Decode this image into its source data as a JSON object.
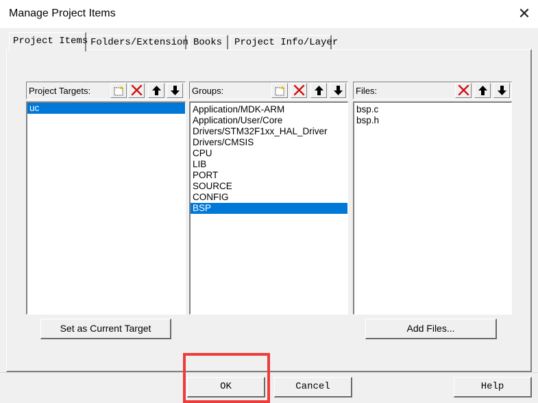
{
  "window": {
    "title": "Manage Project Items",
    "close_glyph": "✕"
  },
  "tabs": [
    {
      "label": "Project Items",
      "active": true
    },
    {
      "label": "Folders/Extensions",
      "active": false
    },
    {
      "label": "Books",
      "active": false
    },
    {
      "label": "Project Info/Layer",
      "active": false
    }
  ],
  "targets": {
    "label": "Project Targets:",
    "items": [
      "uc"
    ],
    "selected": "uc",
    "toolbar_icons": [
      "new-item-icon",
      "delete-icon",
      "move-up-icon",
      "move-down-icon"
    ],
    "set_current_button": "Set as Current Target"
  },
  "groups": {
    "label": "Groups:",
    "items": [
      "Application/MDK-ARM",
      "Application/User/Core",
      "Drivers/STM32F1xx_HAL_Driver",
      "Drivers/CMSIS",
      "CPU",
      "LIB",
      "PORT",
      "SOURCE",
      "CONFIG",
      "BSP"
    ],
    "selected": "BSP",
    "toolbar_icons": [
      "new-item-icon",
      "delete-icon",
      "move-up-icon",
      "move-down-icon"
    ]
  },
  "files": {
    "label": "Files:",
    "items": [
      "bsp.c",
      "bsp.h"
    ],
    "toolbar_icons": [
      "delete-icon",
      "move-up-icon",
      "move-down-icon"
    ],
    "add_files_button": "Add Files..."
  },
  "footer": {
    "ok": "OK",
    "cancel": "Cancel",
    "help": "Help"
  },
  "colors": {
    "selection": "#0078d7",
    "highlight_box": "#ee3b3b",
    "delete_icon": "#d01010"
  }
}
